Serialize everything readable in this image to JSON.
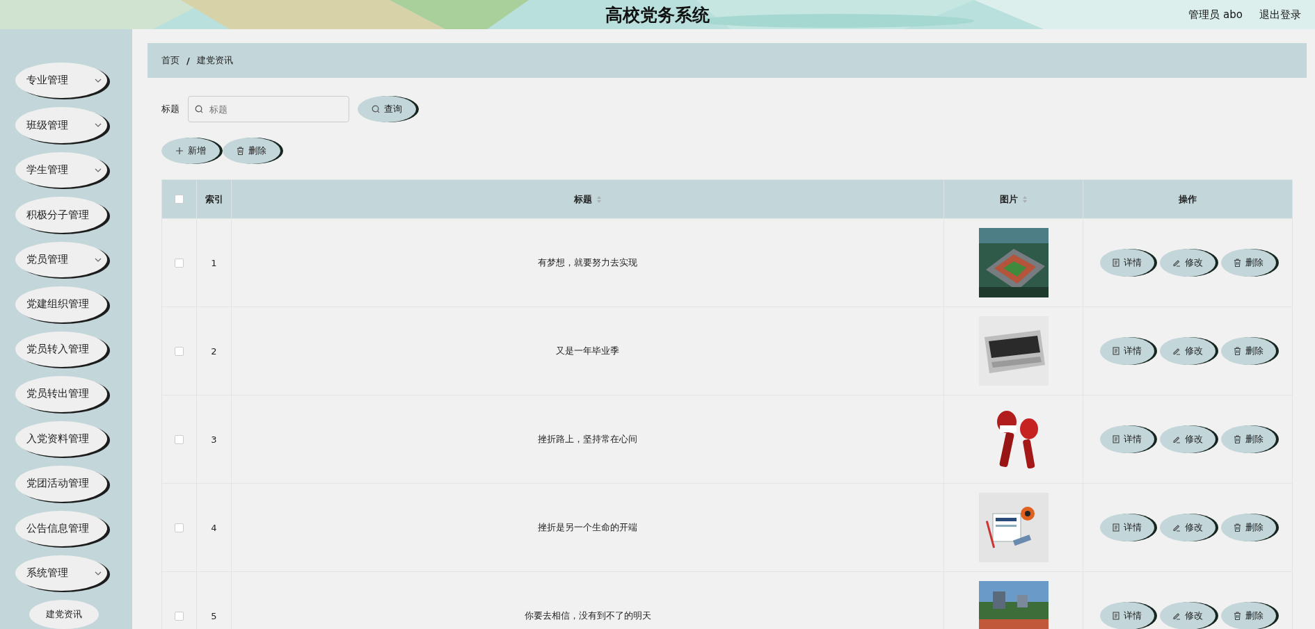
{
  "header": {
    "title": "高校党务系统",
    "user": "管理员 abo",
    "logout": "退出登录"
  },
  "sidebar": {
    "items": [
      {
        "label": "专业管理",
        "has_submenu": true
      },
      {
        "label": "班级管理",
        "has_submenu": true
      },
      {
        "label": "学生管理",
        "has_submenu": true
      },
      {
        "label": "积极分子管理",
        "has_submenu": false
      },
      {
        "label": "党员管理",
        "has_submenu": true
      },
      {
        "label": "党建组织管理",
        "has_submenu": false
      },
      {
        "label": "党员转入管理",
        "has_submenu": false
      },
      {
        "label": "党员转出管理",
        "has_submenu": false
      },
      {
        "label": "入党资料管理",
        "has_submenu": false
      },
      {
        "label": "党团活动管理",
        "has_submenu": false
      },
      {
        "label": "公告信息管理",
        "has_submenu": false
      },
      {
        "label": "系统管理",
        "has_submenu": true,
        "children": [
          {
            "label": "建党资讯"
          }
        ]
      }
    ]
  },
  "breadcrumb": [
    "首页",
    "/",
    "建党资讯"
  ],
  "search": {
    "label": "标题",
    "placeholder": "标题",
    "button": "查询"
  },
  "toolbar": [
    "新增",
    "删除"
  ],
  "table": {
    "all_checked": false,
    "columns": [
      "索引",
      "标题",
      "图片",
      "操作"
    ],
    "rows": [
      {
        "index": "1",
        "title": "有梦想，就要努力去实现",
        "checked": false,
        "actions": [
          "详情",
          "修改",
          "删除"
        ]
      },
      {
        "index": "2",
        "title": "又是一年毕业季",
        "checked": false,
        "actions": [
          "详情",
          "修改",
          "删除"
        ]
      },
      {
        "index": "3",
        "title": "挫折路上，坚持常在心间",
        "checked": false,
        "actions": [
          "详情",
          "修改",
          "删除"
        ]
      },
      {
        "index": "4",
        "title": "挫折是另一个生命的开端",
        "checked": false,
        "actions": [
          "详情",
          "修改",
          "删除"
        ]
      },
      {
        "index": "5",
        "title": "你要去相信，没有到不了的明天",
        "checked": false,
        "actions": [
          "详情",
          "修改",
          "删除"
        ]
      }
    ]
  }
}
